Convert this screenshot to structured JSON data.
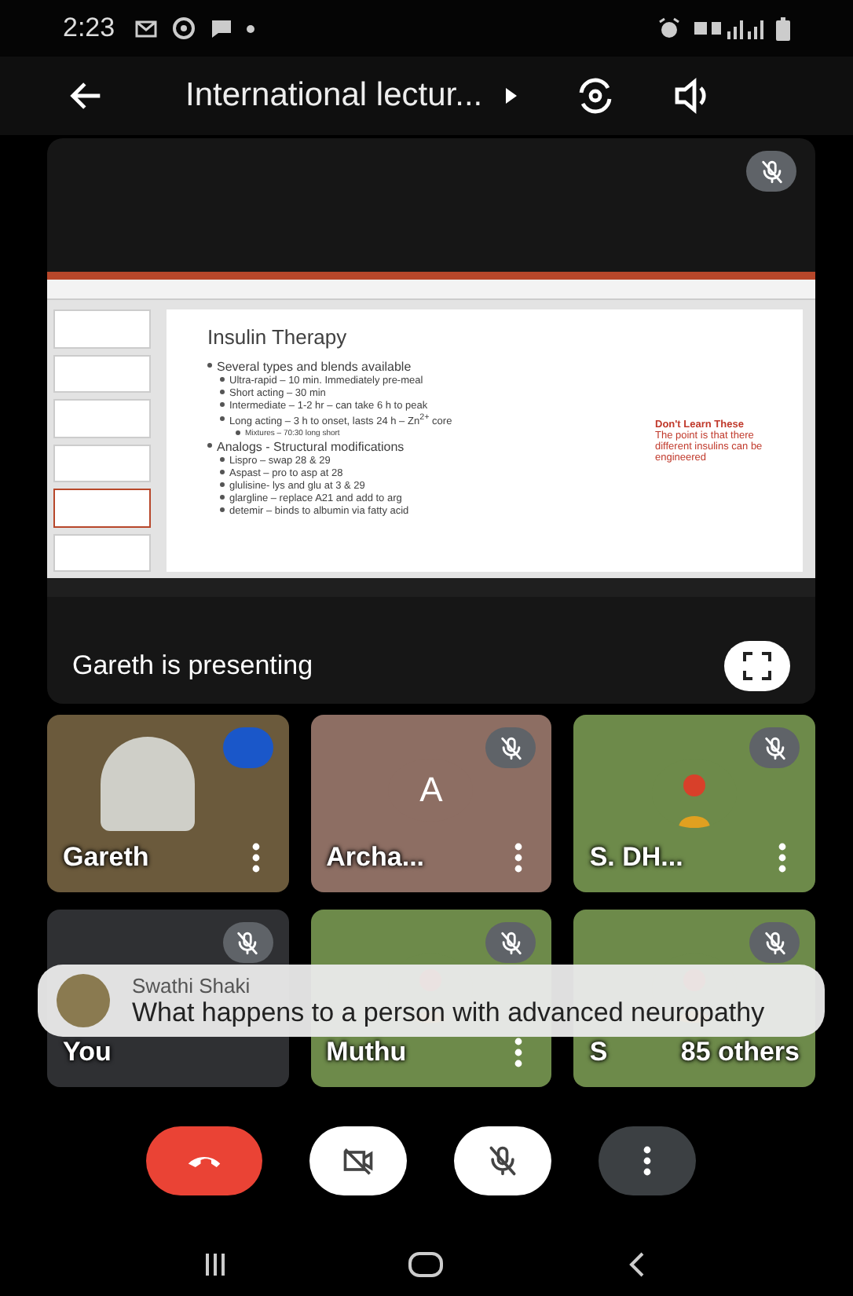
{
  "status_bar": {
    "time": "2:23"
  },
  "header": {
    "title": "International lectur..."
  },
  "presentation": {
    "muted": true,
    "presenter_label": "Gareth is presenting",
    "slide": {
      "title": "Insulin Therapy",
      "bullets": [
        {
          "text": "Several types and blends available",
          "children": [
            {
              "text": "Ultra-rapid – 10 min.  Immediately pre-meal"
            },
            {
              "text": "Short acting – 30 min"
            },
            {
              "text": "Intermediate – 1-2 hr – can take 6 h to peak"
            },
            {
              "text": "Long acting – 3 h to onset, lasts 24 h – Zn$^{2+}$ core",
              "children": [
                {
                  "text": "Mixtures – 70:30 long short"
                }
              ]
            }
          ]
        },
        {
          "text": "Analogs - Structural modifications",
          "children": [
            {
              "text": "Lispro – swap 28 & 29"
            },
            {
              "text": "Aspast – pro to asp at 28"
            },
            {
              "text": "glulisine- lys and glu at 3 & 29"
            },
            {
              "text": "glargline – replace A21 and add to arg"
            },
            {
              "text": "detemir – binds to albumin via fatty acid"
            }
          ]
        }
      ],
      "note_title": "Don't Learn These",
      "note_text": "The point is that there different insulins can be engineered"
    }
  },
  "participants": [
    {
      "kind": "video",
      "name": "Gareth",
      "muted": false,
      "speaking": true,
      "menu": true
    },
    {
      "kind": "initial",
      "name": "Archa...",
      "initial": "A",
      "muted": true,
      "speaking": false,
      "menu": true
    },
    {
      "kind": "photo",
      "name": "S. DH...",
      "muted": true,
      "speaking": false,
      "menu": true
    },
    {
      "kind": "blank",
      "name": "You",
      "muted": true,
      "speaking": false,
      "menu": false
    },
    {
      "kind": "photo",
      "name": "Muthu",
      "muted": true,
      "speaking": false,
      "menu": true
    },
    {
      "kind": "photo",
      "name": "S",
      "extra": "85 others",
      "muted": true,
      "speaking": false,
      "menu": false
    }
  ],
  "chat": {
    "sender": "Swathi Shaki",
    "message": "What happens to a person with advanced neuropathy"
  },
  "controls": [
    {
      "kind": "hangup"
    },
    {
      "kind": "camera",
      "on": false
    },
    {
      "kind": "mic",
      "on": false
    },
    {
      "kind": "more"
    }
  ]
}
